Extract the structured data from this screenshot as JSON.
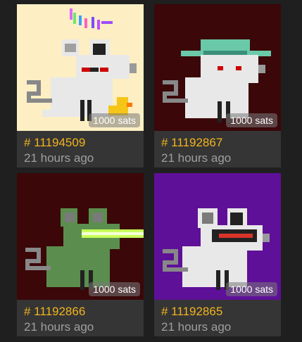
{
  "cards": [
    {
      "id": "# 11194509",
      "time": "21 hours ago",
      "price": "1000 sats",
      "bg": "#fdefc3"
    },
    {
      "id": "# 11192867",
      "time": "21 hours ago",
      "price": "1000 sats",
      "bg": "#3b0709"
    },
    {
      "id": "# 11192866",
      "time": "21 hours ago",
      "price": "1000 sats",
      "bg": "#3b0709"
    },
    {
      "id": "# 11192865",
      "time": "21 hours ago",
      "price": "1000 sats",
      "bg": "#5e1098"
    }
  ]
}
